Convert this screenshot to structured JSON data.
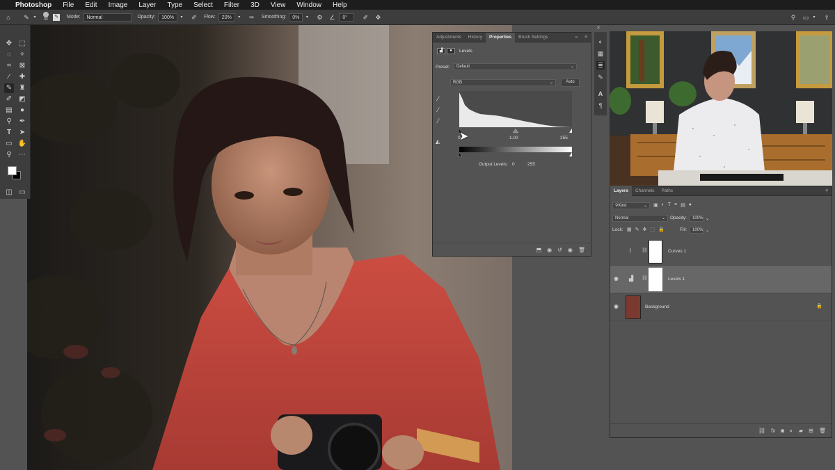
{
  "menubar": {
    "app": "Photoshop",
    "items": [
      "File",
      "Edit",
      "Image",
      "Layer",
      "Type",
      "Select",
      "Filter",
      "3D",
      "View",
      "Window",
      "Help"
    ]
  },
  "options": {
    "brush_size": "93",
    "mode_label": "Mode:",
    "mode_value": "Normal",
    "opacity_label": "Opacity:",
    "opacity_value": "100%",
    "flow_label": "Flow:",
    "flow_value": "20%",
    "smoothing_label": "Smoothing:",
    "smoothing_value": "0%",
    "angle_value": "0°"
  },
  "properties": {
    "tabs": [
      "Adjustments",
      "History",
      "Properties",
      "Brush Settings"
    ],
    "active_tab": "Properties",
    "title": "Levels",
    "preset_label": "Preset:",
    "preset_value": "Default",
    "channel_value": "RGB",
    "auto_label": "Auto",
    "input_black": "0",
    "input_gamma": "1.00",
    "input_white": "255",
    "output_label": "Output Levels:",
    "output_black": "0",
    "output_white": "255"
  },
  "layers_panel": {
    "tabs": [
      "Layers",
      "Channels",
      "Paths"
    ],
    "active_tab": "Layers",
    "kind_label": "Kind",
    "blend_value": "Normal",
    "opacity_label": "Opacity:",
    "opacity_value": "100%",
    "lock_label": "Lock:",
    "fill_label": "Fill:",
    "fill_value": "100%",
    "layers": [
      {
        "name": "Curves 1",
        "visible": false,
        "selected": false
      },
      {
        "name": "Levels 1",
        "visible": true,
        "selected": true
      },
      {
        "name": "Background",
        "visible": true,
        "selected": false,
        "locked": true
      }
    ]
  },
  "colors": {
    "accent": "#2d8ceb",
    "panel_bg": "#535353",
    "panel_dark": "#3d3d3d",
    "menubar": "#1d1d1d",
    "dress_red": "#c1463e"
  }
}
